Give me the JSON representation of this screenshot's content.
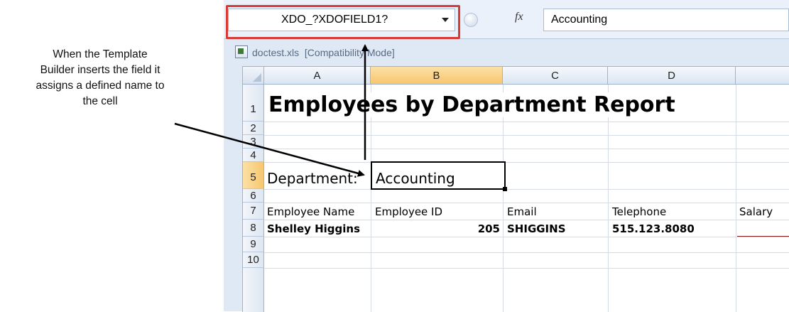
{
  "annotation": {
    "line1": "When the Template",
    "line2": "Builder inserts the field it",
    "line3": "assigns a defined name to",
    "line4": "the cell"
  },
  "formula_bar": {
    "name_box": "XDO_?XDOFIELD1?",
    "fx_label": "fx",
    "formula_value": "Accounting"
  },
  "window": {
    "filename": "doctest.xls",
    "mode": "[Compatibility Mode]"
  },
  "sheet": {
    "columns": [
      "A",
      "B",
      "C",
      "D"
    ],
    "rows": [
      "1",
      "2",
      "3",
      "4",
      "5",
      "6",
      "7",
      "8",
      "9",
      "10"
    ],
    "selected_column": "B",
    "selected_row": "5",
    "title": "Employees by Department Report",
    "department_label": "Department:",
    "department_value": "Accounting",
    "headers": {
      "employee_name": "Employee Name",
      "employee_id": "Employee ID",
      "email": "Email",
      "telephone": "Telephone",
      "salary": "Salary"
    },
    "row8": {
      "employee_name": "Shelley Higgins",
      "employee_id": "205",
      "email": "SHIGGINS",
      "telephone": "515.123.8080"
    }
  },
  "colors": {
    "highlight": "#d63b36",
    "selected_header": "#f7c66f",
    "arrow": "#000000"
  }
}
